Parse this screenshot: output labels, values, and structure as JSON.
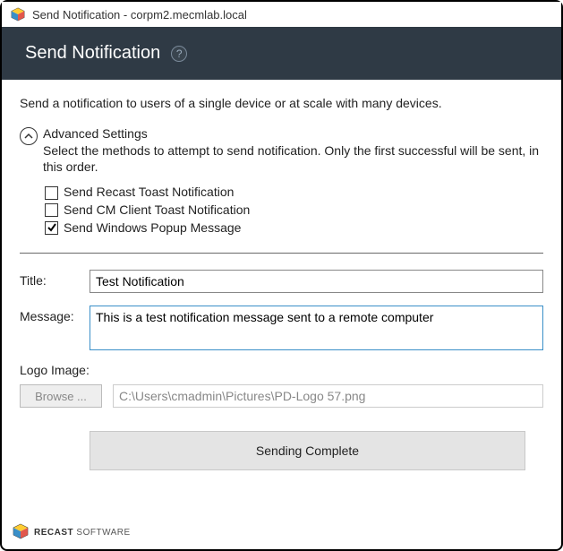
{
  "window": {
    "title": "Send Notification - corpm2.mecmlab.local"
  },
  "header": {
    "title": "Send Notification",
    "help_glyph": "?"
  },
  "description": "Send a notification to users of a single device or at scale with many devices.",
  "advanced": {
    "title": "Advanced Settings",
    "description": "Select the methods to attempt to send notification. Only the first successful will be sent, in this order.",
    "options": [
      {
        "label": "Send Recast Toast Notification",
        "checked": false
      },
      {
        "label": "Send CM Client Toast Notification",
        "checked": false
      },
      {
        "label": "Send Windows Popup Message",
        "checked": true
      }
    ]
  },
  "form": {
    "title_label": "Title:",
    "title_value": "Test Notification",
    "message_label": "Message:",
    "message_value": "This is a test notification message sent to a remote computer",
    "logo_label": "Logo Image:",
    "browse_label": "Browse ...",
    "logo_path": "C:\\Users\\cmadmin\\Pictures\\PD-Logo 57.png"
  },
  "action": {
    "button_label": "Sending Complete"
  },
  "footer": {
    "brand_bold": "RECAST",
    "brand_light": " SOFTWARE"
  }
}
